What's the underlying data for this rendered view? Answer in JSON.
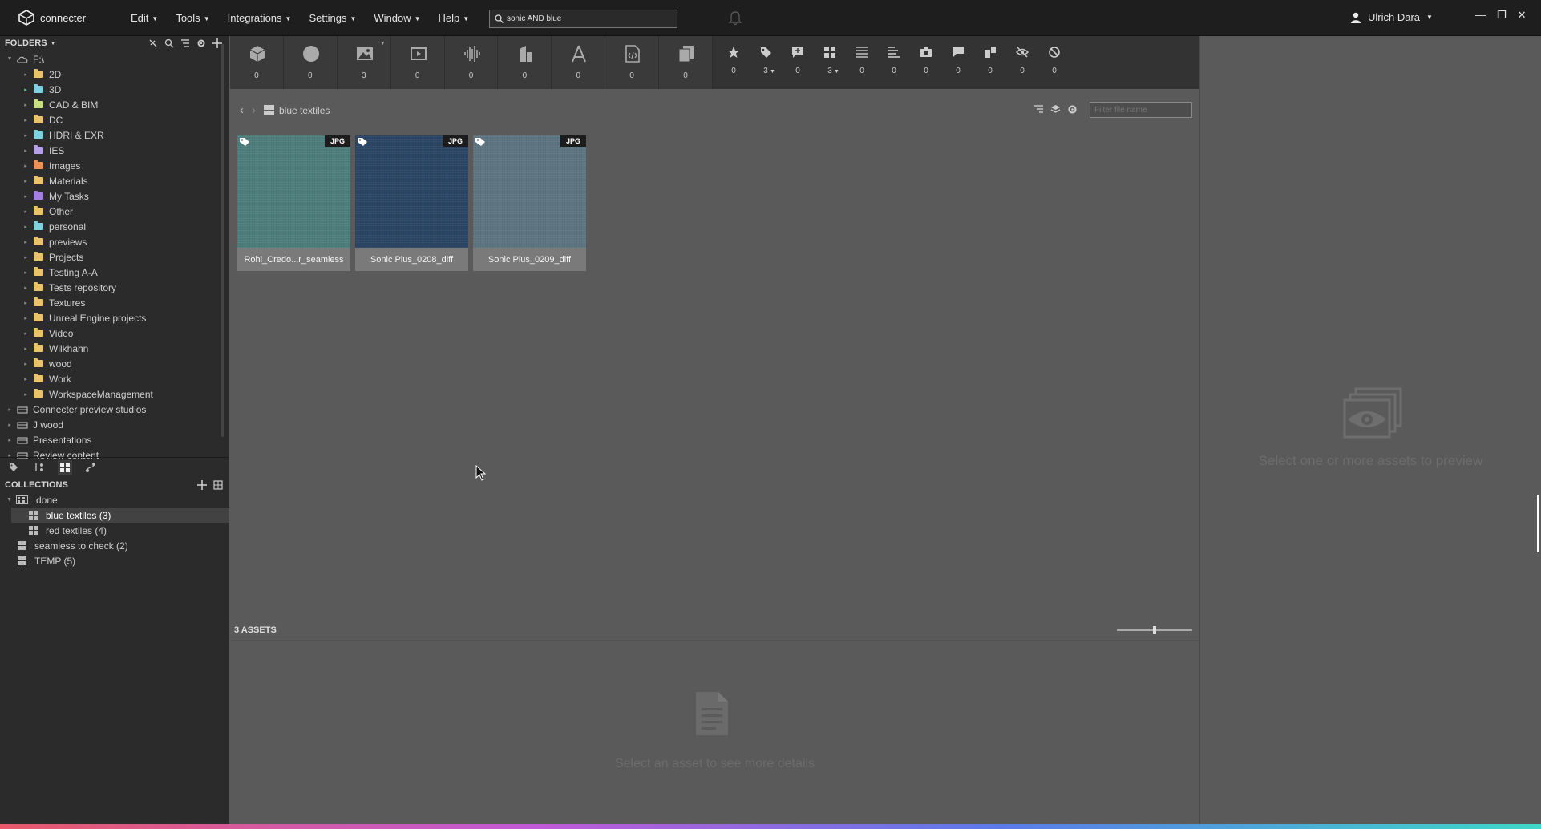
{
  "app": {
    "name": "connecter",
    "search_value": "sonic AND blue",
    "user_name": "Ulrich Dara"
  },
  "menu": [
    {
      "label": "Edit"
    },
    {
      "label": "Tools"
    },
    {
      "label": "Integrations"
    },
    {
      "label": "Settings"
    },
    {
      "label": "Window"
    },
    {
      "label": "Help"
    }
  ],
  "folders": {
    "header": "FOLDERS",
    "root": "F:\\",
    "items": [
      {
        "label": "2D",
        "color": "#e8c36a"
      },
      {
        "label": "3D",
        "color": "#7fd1e0"
      },
      {
        "label": "CAD & BIM",
        "color": "#c8e07f"
      },
      {
        "label": "DC",
        "color": "#e8c36a"
      },
      {
        "label": "HDRI & EXR",
        "color": "#7fd1e0"
      },
      {
        "label": "IES",
        "color": "#b5a0e8"
      },
      {
        "label": "Images",
        "color": "#e8935a"
      },
      {
        "label": "Materials",
        "color": "#e8c36a"
      },
      {
        "label": "My Tasks",
        "color": "#a57fe0"
      },
      {
        "label": "Other",
        "color": "#e8c36a"
      },
      {
        "label": "personal",
        "color": "#7fd1e0"
      },
      {
        "label": "previews",
        "color": "#e8c36a"
      },
      {
        "label": "Projects",
        "color": "#e8c36a"
      },
      {
        "label": "Testing A-A",
        "color": "#e8c36a"
      },
      {
        "label": "Tests repository",
        "color": "#e8c36a"
      },
      {
        "label": "Textures",
        "color": "#e8c36a"
      },
      {
        "label": "Unreal Engine projects",
        "color": "#e8c36a"
      },
      {
        "label": "Video",
        "color": "#e8c36a"
      },
      {
        "label": "Wilkhahn",
        "color": "#e8c36a"
      },
      {
        "label": "wood",
        "color": "#e8c36a"
      },
      {
        "label": "Work",
        "color": "#e8c36a"
      },
      {
        "label": "WorkspaceManagement",
        "color": "#e8c36a"
      }
    ],
    "others": [
      {
        "label": "Connecter preview studios"
      },
      {
        "label": "J wood"
      },
      {
        "label": "Presentations"
      },
      {
        "label": "Review content"
      }
    ]
  },
  "collections": {
    "header": "COLLECTIONS",
    "items": [
      {
        "label": "done"
      },
      {
        "label": "blue textiles  (3)"
      },
      {
        "label": "red textiles  (4)"
      },
      {
        "label": "seamless to check  (2)"
      },
      {
        "label": "TEMP  (5)"
      }
    ]
  },
  "type_filters": [
    {
      "icon": "cube-icon",
      "count": "0"
    },
    {
      "icon": "sphere-icon",
      "count": "0"
    },
    {
      "icon": "image-icon",
      "count": "3"
    },
    {
      "icon": "video-icon",
      "count": "0"
    },
    {
      "icon": "audio-icon",
      "count": "0"
    },
    {
      "icon": "building-icon",
      "count": "0"
    },
    {
      "icon": "drafting-icon",
      "count": "0"
    },
    {
      "icon": "code-file-icon",
      "count": "0"
    },
    {
      "icon": "documents-icon",
      "count": "0"
    }
  ],
  "meta_filters": [
    {
      "icon": "star-icon",
      "count": "0"
    },
    {
      "icon": "tag-icon",
      "count": "3"
    },
    {
      "icon": "comment-plus-icon",
      "count": "0"
    },
    {
      "icon": "collection-icon",
      "count": "3"
    },
    {
      "icon": "list-icon",
      "count": "0"
    },
    {
      "icon": "align-icon",
      "count": "0"
    },
    {
      "icon": "camera-icon",
      "count": "0"
    },
    {
      "icon": "chat-icon",
      "count": "0"
    },
    {
      "icon": "split-icon",
      "count": "0"
    },
    {
      "icon": "hidden-icon",
      "count": "0"
    },
    {
      "icon": "blocked-icon",
      "count": "0"
    }
  ],
  "breadcrumb": "blue textiles",
  "filter_placeholder": "Filter file name",
  "assets": [
    {
      "name": "Rohi_Credo...r_seamless",
      "type": "JPG",
      "color": "#4e7e7c"
    },
    {
      "name": "Sonic Plus_0208_diff",
      "type": "JPG",
      "color": "#2b4565"
    },
    {
      "name": "Sonic Plus_0209_diff",
      "type": "JPG",
      "color": "#5d7581"
    }
  ],
  "asset_count": "3 ASSETS",
  "zoom_level": 0.5,
  "details_msg": "Select an asset to see more details",
  "preview_msg": "Select one or more assets to preview"
}
